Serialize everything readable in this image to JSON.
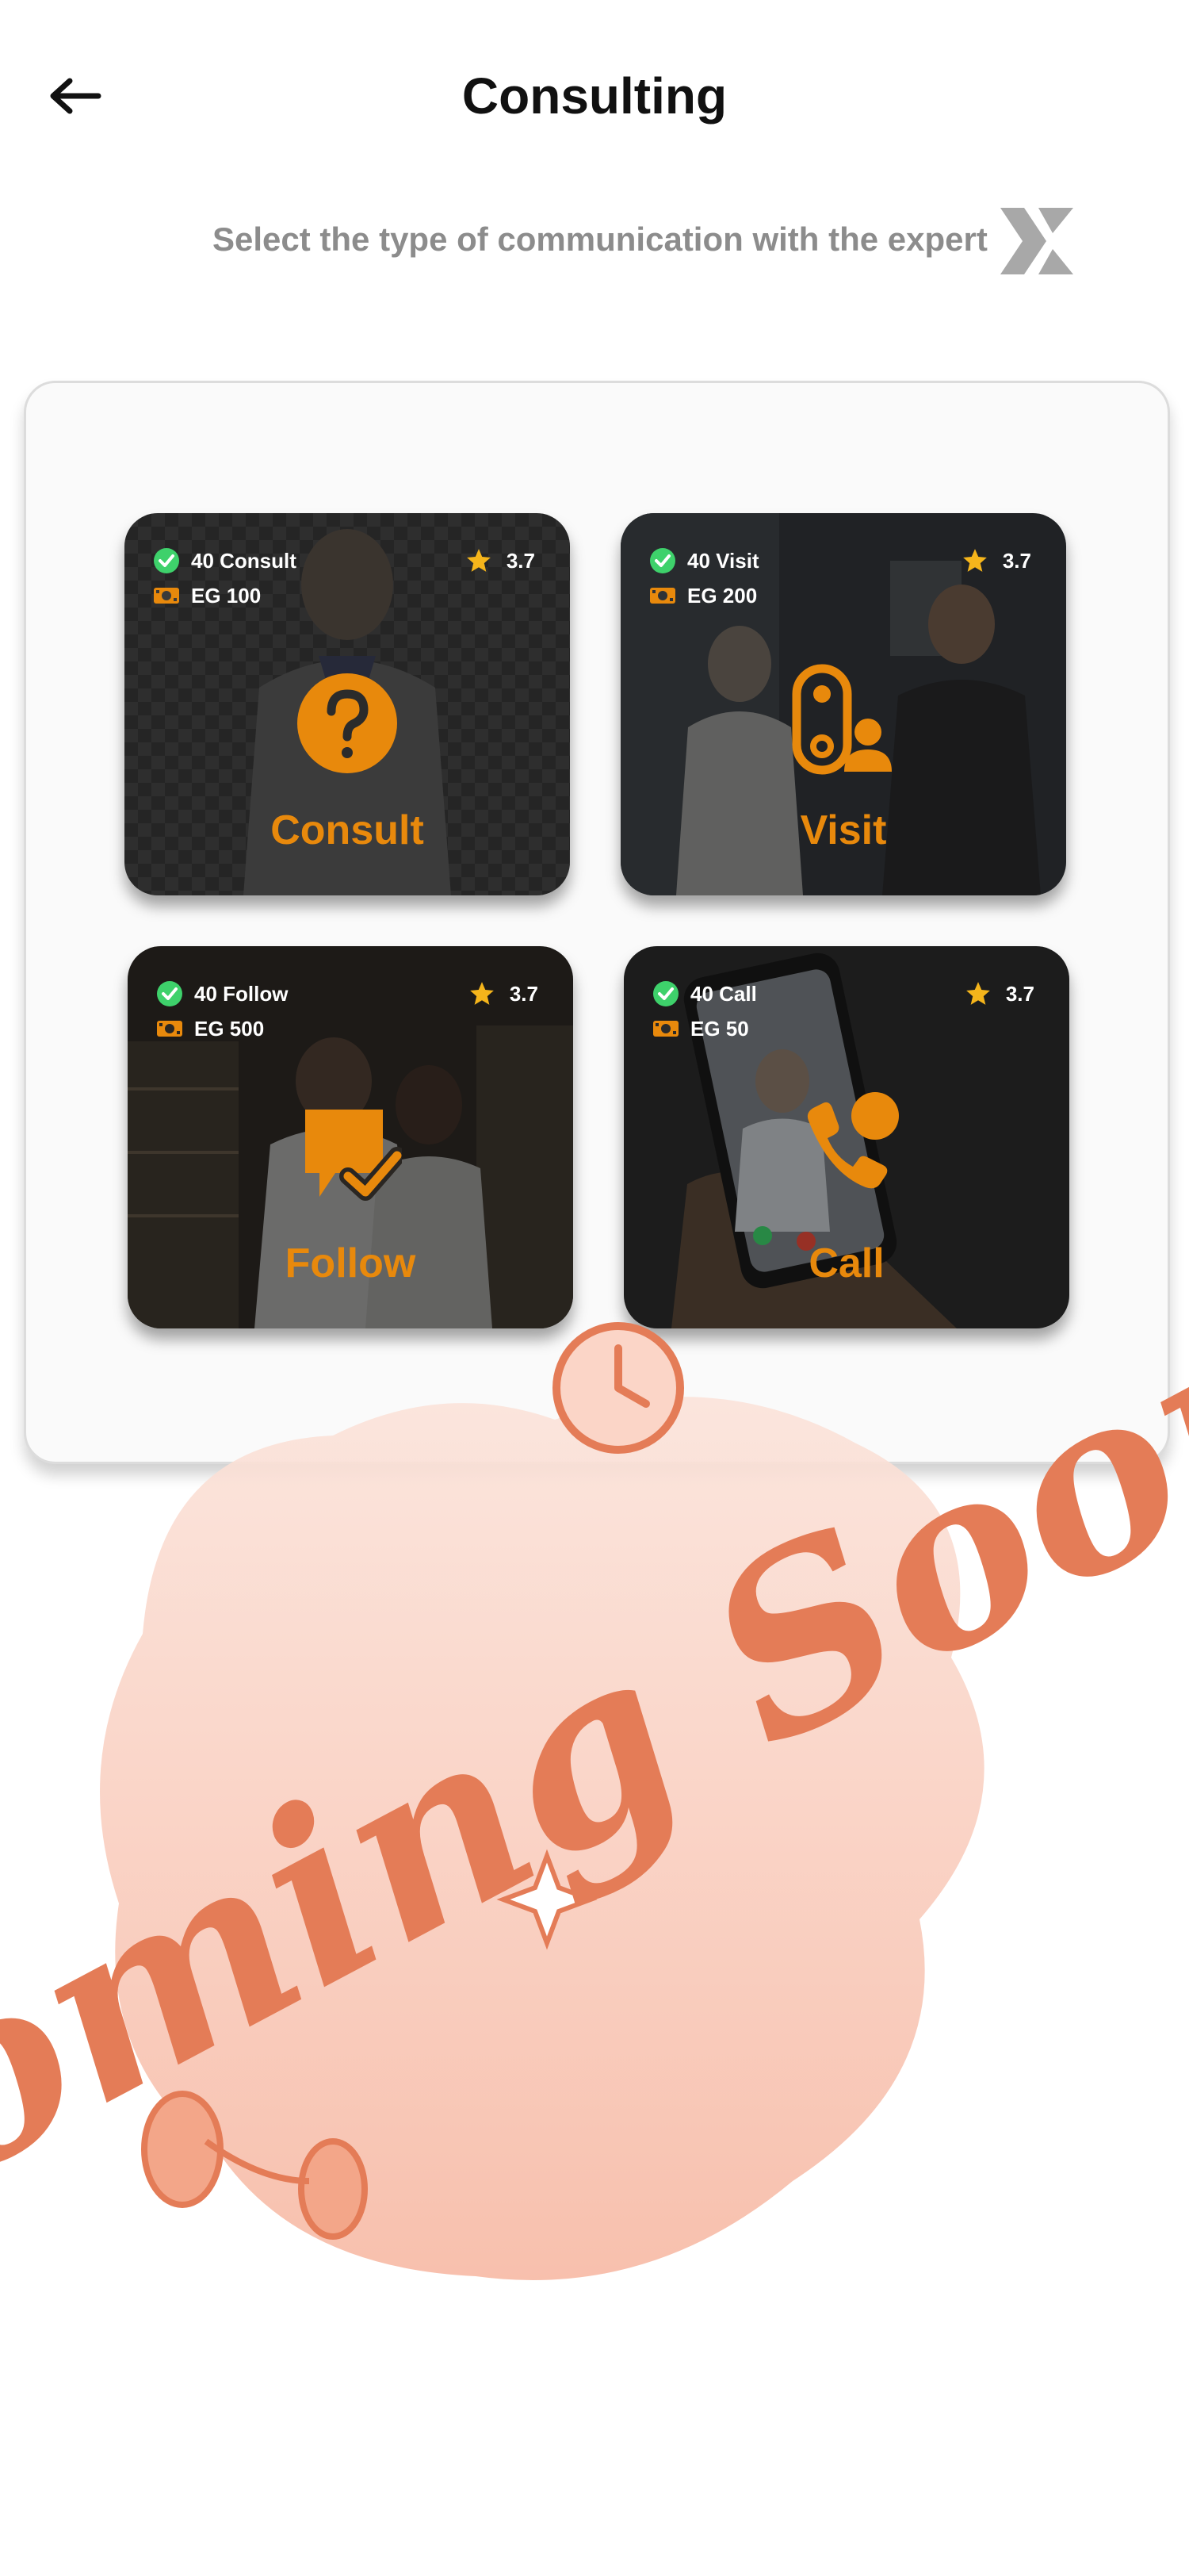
{
  "header": {
    "title": "Consulting",
    "back_icon": "arrow-left-icon"
  },
  "subtitle": "Select the type of communication with the expert",
  "logo_icon": "x-logo-icon",
  "colors": {
    "accent": "#e8890c",
    "check": "#3ed16b",
    "star": "#f5b51b",
    "coming_soon": "#e47c57"
  },
  "cards": [
    {
      "label": "Consult",
      "count": "40 Consult",
      "price": "EG 100",
      "rating": "3.7",
      "icon": "question-mark-icon"
    },
    {
      "label": "Visit",
      "count": "40 Visit",
      "price": "EG 200",
      "rating": "3.7",
      "icon": "visit-person-icon"
    },
    {
      "label": "Follow",
      "count": "40 Follow",
      "price": "EG 500",
      "rating": "3.7",
      "icon": "chat-check-icon"
    },
    {
      "label": "Call",
      "count": "40 Call",
      "price": "EG 50",
      "rating": "3.7",
      "icon": "phone-call-icon"
    }
  ],
  "overlay": {
    "text": "Coming Soon"
  }
}
